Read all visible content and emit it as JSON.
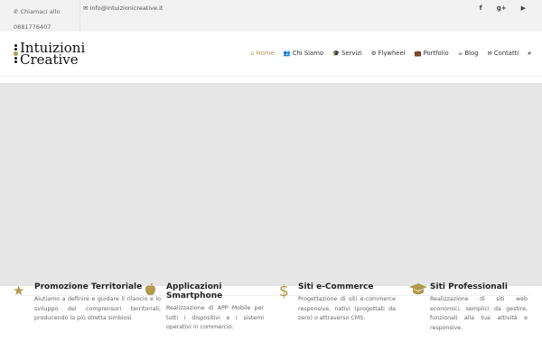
{
  "topbar": {
    "phone_label": "Chiamaci allo",
    "phone_number": "0881776407",
    "email": "info@intuizionicreative.it",
    "social": [
      {
        "icon": "facebook-icon",
        "glyph": "f"
      },
      {
        "icon": "google-plus-icon",
        "glyph": "g+"
      },
      {
        "icon": "youtube-icon",
        "glyph": "▶"
      }
    ]
  },
  "logo": {
    "line1": "Intuizioni",
    "line2": "Creative"
  },
  "nav": [
    {
      "label": "Home",
      "glyph": "⌂",
      "icon": "home-icon"
    },
    {
      "label": "Chi Siamo",
      "glyph": "👥",
      "icon": "users-icon"
    },
    {
      "label": "Servizi",
      "glyph": "🎓",
      "icon": "graduation-cap-icon"
    },
    {
      "label": "Flywheel",
      "glyph": "⚙",
      "icon": "gear-icon"
    },
    {
      "label": "Portfolio",
      "glyph": "💼",
      "icon": "briefcase-icon"
    },
    {
      "label": "Blog",
      "glyph": "☕",
      "icon": "coffee-icon"
    },
    {
      "label": "Contatti",
      "glyph": "✉",
      "icon": "envelope-icon"
    }
  ],
  "features": [
    {
      "title": "Promozione Territoriale",
      "text": "Aiutiamo a definire e guidare il rilancio e lo sviluppo dei comprensori territoriali, producendo la più stretta simbiosi",
      "glyph": "★"
    },
    {
      "title": "Applicazioni Smartphone",
      "text": "Realizzazione di APP Mobile per tutti i dispositivi e i sistemi operativi in commercio.",
      "glyph": ""
    },
    {
      "title": "Siti e-Commerce",
      "text": "Progettazione di siti e-commerce responsive, nativi (progettati da zero) o attraverso CMS.",
      "glyph": "$"
    },
    {
      "title": "Siti Professionali",
      "text": "Realizzazione di siti web economici, semplici da gestire, funzionali alla tua attività e responsive.",
      "glyph": "🎓"
    }
  ],
  "colors": {
    "accent": "#b09a4e",
    "hero": "#e6e6e6",
    "topbar": "#f2f2f2"
  }
}
